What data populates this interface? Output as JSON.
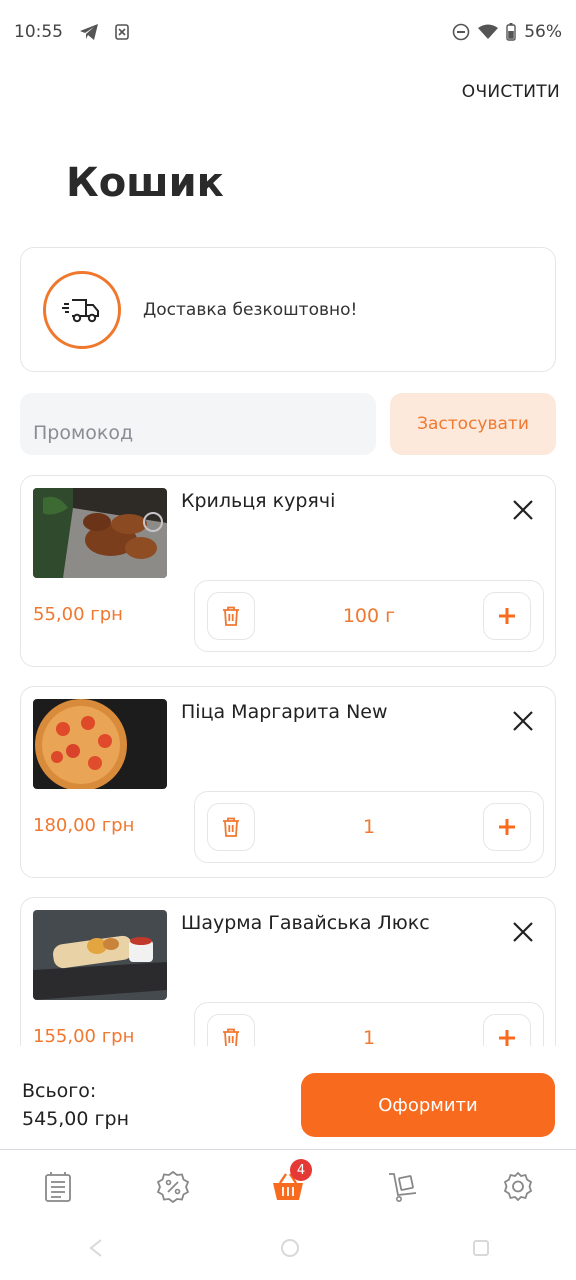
{
  "status_bar": {
    "time": "10:55",
    "battery": "56%"
  },
  "header": {
    "clear_label": "ОЧИСТИТИ",
    "title": "Кошик"
  },
  "delivery": {
    "text": "Доставка безкоштовно!"
  },
  "promo": {
    "placeholder": "Промокод",
    "apply_label": "Застосувати"
  },
  "cart_items": [
    {
      "name": "Крильця курячі",
      "price": "55,00 грн",
      "quantity": "100 г"
    },
    {
      "name": "Піца Маргарита New",
      "price": "180,00 грн",
      "quantity": "1"
    },
    {
      "name": "Шаурма Гавайська Люкс",
      "price": "155,00 грн",
      "quantity": "1"
    }
  ],
  "summary": {
    "total_label": "Всього:",
    "total_value": "545,00 грн",
    "checkout_label": "Оформити"
  },
  "nav": {
    "items": [
      {
        "icon": "menu-list-icon"
      },
      {
        "icon": "discount-icon"
      },
      {
        "icon": "basket-icon",
        "badge": "4"
      },
      {
        "icon": "delivery-cart-icon"
      },
      {
        "icon": "settings-gear-icon"
      }
    ]
  },
  "colors": {
    "accent": "#f86b1e",
    "accent_text": "#f07830",
    "badge": "#e53935"
  }
}
